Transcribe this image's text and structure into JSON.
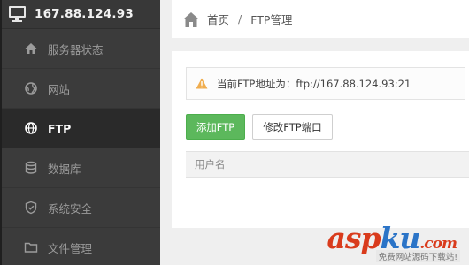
{
  "server": {
    "ip": "167.88.124.93",
    "icon": "monitor-icon"
  },
  "sidebar": {
    "items": [
      {
        "label": "服务器状态",
        "icon": "home-icon",
        "active": false
      },
      {
        "label": "网站",
        "icon": "globe-icon",
        "active": false
      },
      {
        "label": "FTP",
        "icon": "globe-icon",
        "active": true
      },
      {
        "label": "数据库",
        "icon": "database-icon",
        "active": false
      },
      {
        "label": "系统安全",
        "icon": "shield-icon",
        "active": false
      },
      {
        "label": "文件管理",
        "icon": "folder-icon",
        "active": false
      }
    ]
  },
  "breadcrumb": {
    "home": "首页",
    "separator": "/",
    "current": "FTP管理"
  },
  "alert": {
    "icon": "warning-icon",
    "text": "当前FTP地址为：ftp://167.88.124.93:21"
  },
  "buttons": {
    "add": "添加FTP",
    "port": "修改FTP端口"
  },
  "table": {
    "columns": [
      "用户名"
    ]
  },
  "watermark": {
    "logo_asp": "asp",
    "logo_ku": "ku",
    "logo_cn": ".com",
    "tagline": "免费网站源码下载站!"
  },
  "colors": {
    "sidebar_bg": "#3b3b3b",
    "accent_green": "#5cb85c",
    "warning": "#f0ad4e",
    "logo_red": "#d93b1c",
    "logo_blue": "#2b74c7"
  }
}
